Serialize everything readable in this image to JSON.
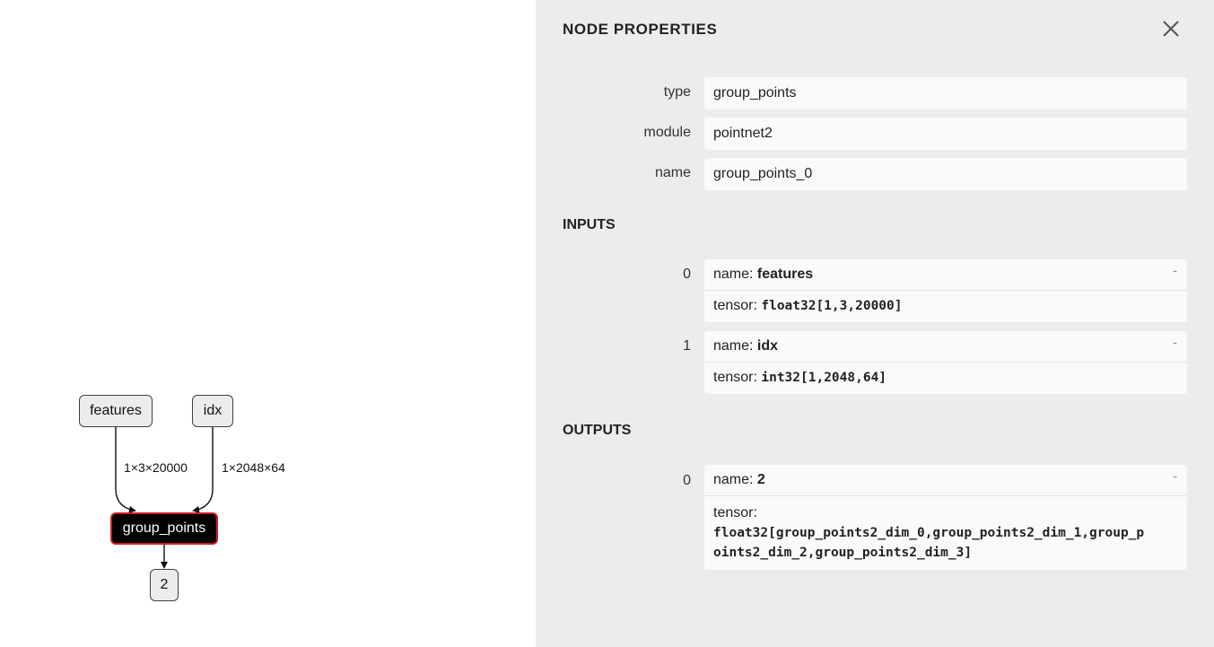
{
  "graph": {
    "nodes": {
      "features": "features",
      "idx": "idx",
      "group": "group_points",
      "output": "2"
    },
    "edges": [
      "1×3×20000",
      "1×2048×64"
    ]
  },
  "panel": {
    "title": "NODE PROPERTIES",
    "close_glyph": "×",
    "properties": [
      {
        "label": "type",
        "value": "group_points"
      },
      {
        "label": "module",
        "value": "pointnet2"
      },
      {
        "label": "name",
        "value": "group_points_0"
      }
    ],
    "inputs_heading": "INPUTS",
    "inputs": [
      {
        "index": "0",
        "name_prefix": "name: ",
        "name": "features",
        "tensor_prefix": "tensor: ",
        "tensor": "float32[1,3,20000]",
        "expander": "-"
      },
      {
        "index": "1",
        "name_prefix": "name: ",
        "name": "idx",
        "tensor_prefix": "tensor: ",
        "tensor": "int32[1,2048,64]",
        "expander": "-"
      }
    ],
    "outputs_heading": "OUTPUTS",
    "outputs": [
      {
        "index": "0",
        "name_prefix": "name: ",
        "name": "2",
        "tensor_prefix": "tensor:",
        "tensor": "float32[group_points2_dim_0,group_points2_dim_1,group_points2_dim_2,group_points2_dim_3]",
        "expander": "-"
      }
    ]
  },
  "icons": {
    "close": "close-icon"
  },
  "colors": {
    "panel_bg": "#ececec",
    "selected_node_border": "#d21d1d",
    "selected_node_fill": "#000000"
  }
}
